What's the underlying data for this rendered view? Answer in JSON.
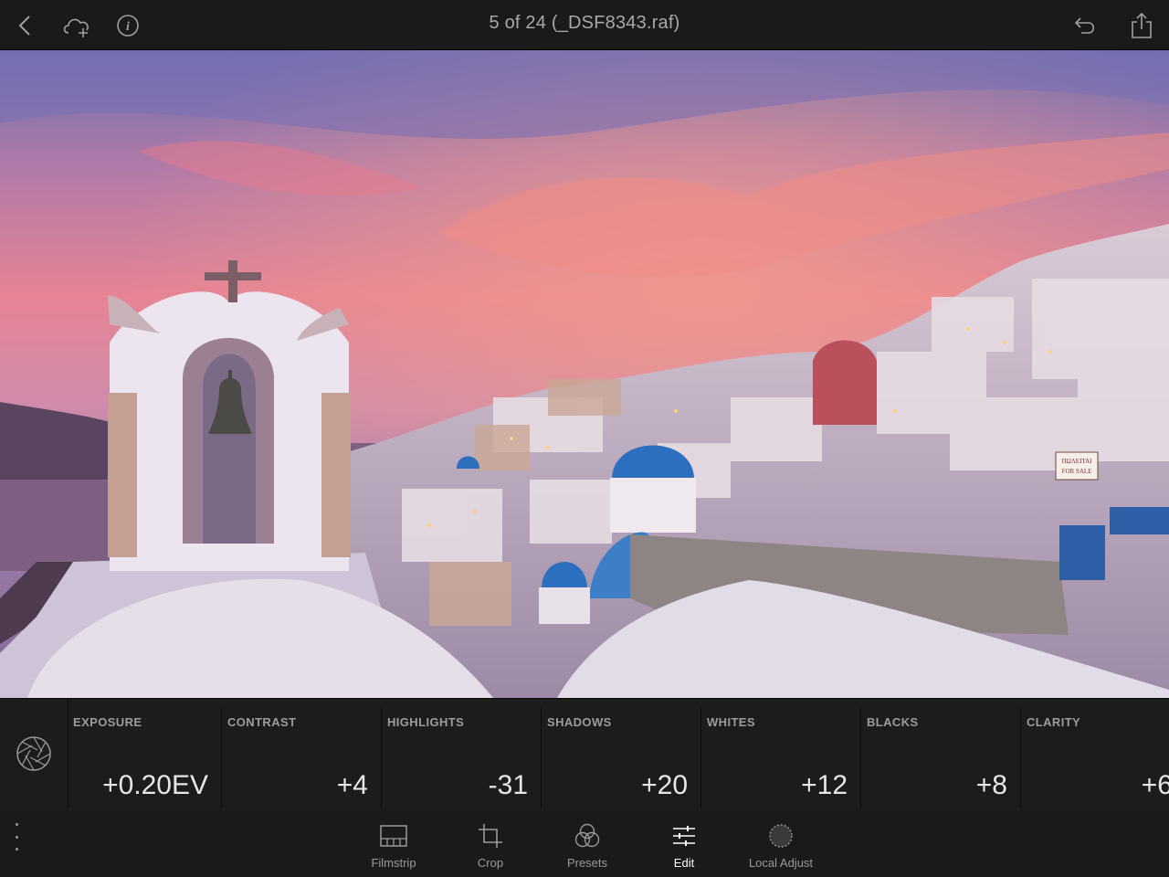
{
  "header": {
    "title": "5 of 24 (_DSF8343.raf)",
    "icons": [
      "back-icon",
      "cloud-add-icon",
      "info-icon",
      "undo-icon",
      "share-icon"
    ]
  },
  "photo": {
    "sign_line1": "ΠΩΛΕΙΤΑΙ",
    "sign_line2": "FOR SALE"
  },
  "adjustments": [
    {
      "name": "EXPOSURE",
      "value": "+0.20EV"
    },
    {
      "name": "CONTRAST",
      "value": "+4"
    },
    {
      "name": "HIGHLIGHTS",
      "value": "-31"
    },
    {
      "name": "SHADOWS",
      "value": "+20"
    },
    {
      "name": "WHITES",
      "value": "+12"
    },
    {
      "name": "BLACKS",
      "value": "+8"
    },
    {
      "name": "CLARITY",
      "value": "+6"
    }
  ],
  "toolbar": {
    "items": [
      {
        "label": "Filmstrip",
        "icon": "filmstrip-icon"
      },
      {
        "label": "Crop",
        "icon": "crop-icon"
      },
      {
        "label": "Presets",
        "icon": "presets-icon"
      },
      {
        "label": "Edit",
        "icon": "edit-sliders-icon",
        "active": true
      },
      {
        "label": "Local Adjust",
        "icon": "local-adjust-icon"
      }
    ]
  },
  "colors": {
    "background": "#141414",
    "panel": "#1c1c1c",
    "active_label": "#ffffff",
    "label": "#9a9a9a"
  }
}
